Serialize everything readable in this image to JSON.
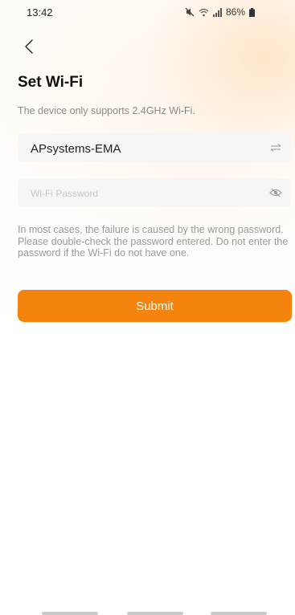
{
  "status_bar": {
    "time": "13:42",
    "battery": "86%",
    "icons": [
      "mute-icon",
      "wifi-icon",
      "signal-icon",
      "battery-icon"
    ]
  },
  "header": {
    "back_icon": "chevron-left-icon",
    "title": "Set Wi-Fi",
    "subtitle": "The device only supports 2.4GHz Wi-Fi."
  },
  "form": {
    "ssid_value": "APsystems-EMA",
    "ssid_icon": "switch-arrows-icon",
    "password_value": "",
    "password_placeholder": "Wi-Fi Password",
    "password_icon": "eye-off-icon",
    "hint": "In most cases, the failure is caused by the wrong password. Please double-check the password entered. Do not enter the password if the Wi-Fi do not have one.",
    "submit_label": "Submit"
  },
  "colors": {
    "accent": "#f5840f",
    "field_bg": "#f6f6f6",
    "hint_text": "#9a9a9a"
  }
}
